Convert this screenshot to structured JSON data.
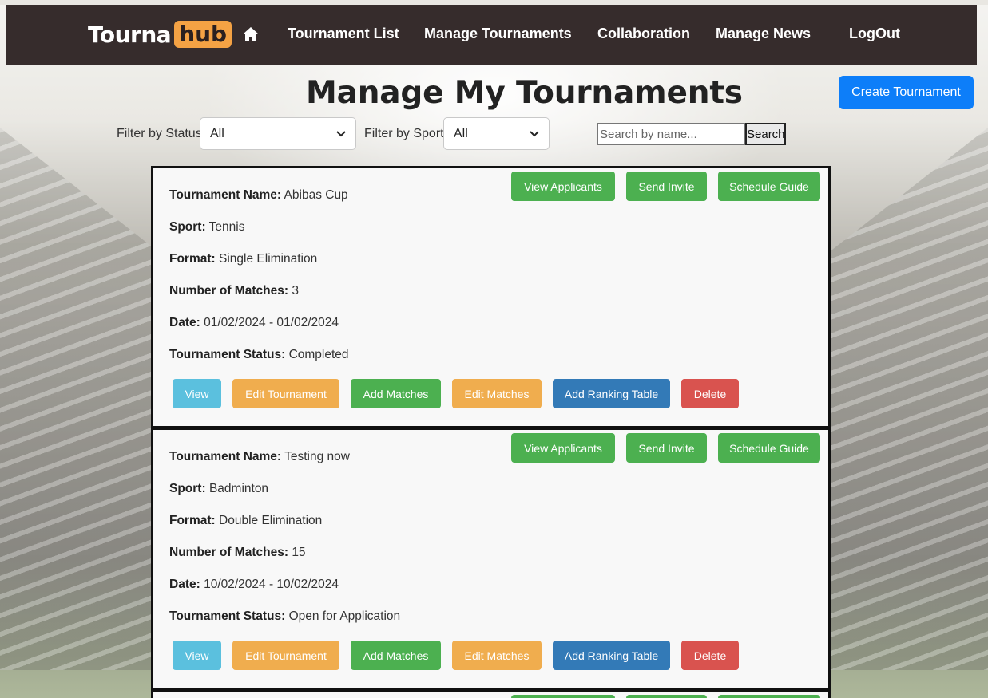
{
  "brand": {
    "name": "Tourna",
    "accent": "hub"
  },
  "nav": {
    "home_icon": "home-icon",
    "links": [
      "Tournament List",
      "Manage Tournaments",
      "Collaboration",
      "Manage News",
      "LogOut"
    ]
  },
  "header": {
    "title": "Manage My Tournaments",
    "create_label": "Create Tournament"
  },
  "filters": {
    "status_label": "Filter by Status",
    "status_value": "All",
    "sport_label": "Filter by Sport",
    "sport_value": "All",
    "search_placeholder": "Search by name...",
    "search_button": "Search"
  },
  "card_labels": {
    "name": "Tournament Name:",
    "sport": "Sport:",
    "format": "Format:",
    "matches": "Number of Matches:",
    "date": "Date:",
    "status": "Tournament Status:"
  },
  "top_actions": [
    "View Applicants",
    "Send Invite",
    "Schedule Guide"
  ],
  "bottom_actions": [
    "View",
    "Edit Tournament",
    "Add Matches",
    "Edit Matches",
    "Add Ranking Table",
    "Delete"
  ],
  "tournaments": [
    {
      "name": "Abibas Cup",
      "sport": "Tennis",
      "format": "Single Elimination",
      "matches": "3",
      "date": "01/02/2024 - 01/02/2024",
      "status": "Completed"
    },
    {
      "name": "Testing now",
      "sport": "Badminton",
      "format": "Double Elimination",
      "matches": "15",
      "date": "10/02/2024 - 10/02/2024",
      "status": "Open for Application"
    }
  ],
  "colors": {
    "navbar": "#362c2c",
    "brand_accent": "#f4a244",
    "primary": "#0d7ef9",
    "success": "#4cb050",
    "info": "#5bc0de",
    "warning": "#f0ad4e",
    "dark_blue": "#337ab7",
    "danger": "#d9534f"
  }
}
